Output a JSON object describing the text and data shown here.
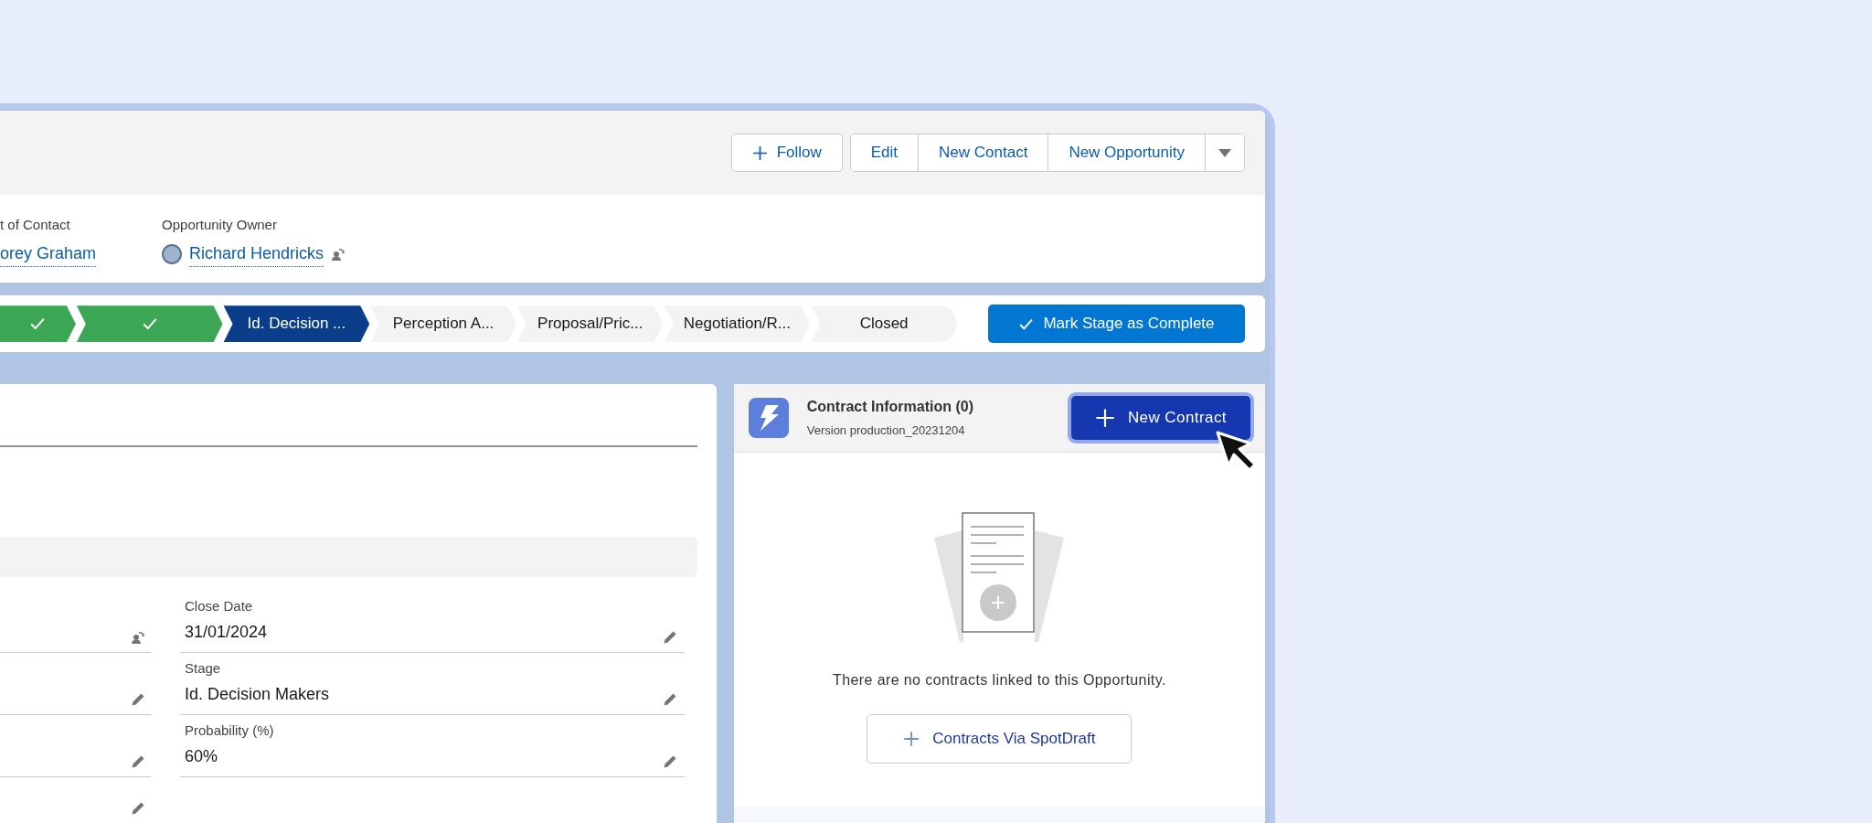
{
  "header": {
    "actions": [
      {
        "label": "Follow",
        "kind": "follow"
      }
    ],
    "action_group": [
      "Edit",
      "New Contact",
      "New Opportunity"
    ],
    "fields": [
      {
        "label": "t of Contact",
        "value": "orey Graham",
        "kind": "plain"
      },
      {
        "label": "Opportunity Owner",
        "value": "Richard Hendricks",
        "kind": "owner"
      }
    ]
  },
  "path": {
    "stages": [
      {
        "completed": true,
        "selected": false
      },
      {
        "completed": true,
        "selected": false
      },
      {
        "label": "Id. Decision ...",
        "completed": false,
        "selected": true
      },
      {
        "label": "Perception A...",
        "completed": false,
        "selected": false
      },
      {
        "label": "Proposal/Pric...",
        "completed": false,
        "selected": false
      },
      {
        "label": "Negotiation/R...",
        "completed": false,
        "selected": false
      },
      {
        "label": "Closed",
        "completed": false,
        "selected": false
      }
    ],
    "button": "Mark Stage as Complete"
  },
  "details": {
    "left_rows": [
      {
        "kind": "owner"
      },
      {
        "kind": "edit"
      },
      {
        "kind": "edit"
      },
      {
        "kind": "edit"
      }
    ],
    "right_rows": [
      {
        "label": "Close Date",
        "value": "31/01/2024"
      },
      {
        "label": "Stage",
        "value": "Id. Decision Makers"
      },
      {
        "label": "Probability (%)",
        "value": "60%"
      }
    ]
  },
  "contract_panel": {
    "title": "Contract Information (0)",
    "version": "Version production_20231204",
    "new_button": "New Contract",
    "empty_text": "There are no contracts linked to this Opportunity.",
    "link_button": "Contracts Via SpotDraft"
  }
}
